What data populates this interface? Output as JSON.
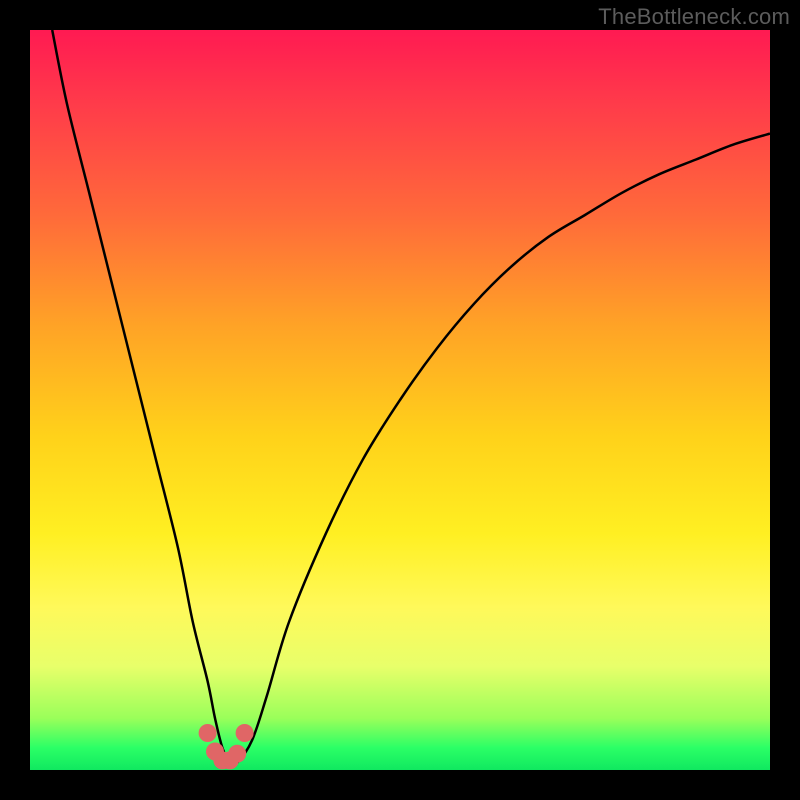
{
  "watermark": "TheBottleneck.com",
  "colors": {
    "frame": "#000000",
    "gradient_top": "#ff1a52",
    "gradient_bottom": "#10e860",
    "curve": "#000000",
    "marker": "#e06666"
  },
  "chart_data": {
    "type": "line",
    "title": "",
    "xlabel": "",
    "ylabel": "",
    "xlim": [
      0,
      100
    ],
    "ylim": [
      0,
      100
    ],
    "series": [
      {
        "name": "curve",
        "x": [
          3,
          5,
          8,
          11,
          14,
          17,
          20,
          22,
          24,
          25,
          26,
          27,
          28,
          30,
          32,
          35,
          40,
          45,
          50,
          55,
          60,
          65,
          70,
          75,
          80,
          85,
          90,
          95,
          100
        ],
        "y": [
          100,
          90,
          78,
          66,
          54,
          42,
          30,
          20,
          12,
          7,
          3,
          1,
          1,
          4,
          10,
          20,
          32,
          42,
          50,
          57,
          63,
          68,
          72,
          75,
          78,
          80.5,
          82.5,
          84.5,
          86
        ]
      }
    ],
    "markers": {
      "name": "highlight",
      "points": [
        {
          "x": 24,
          "y": 5
        },
        {
          "x": 25,
          "y": 2.5
        },
        {
          "x": 26,
          "y": 1.3
        },
        {
          "x": 27,
          "y": 1.3
        },
        {
          "x": 28,
          "y": 2.2
        },
        {
          "x": 29,
          "y": 5
        }
      ]
    }
  }
}
